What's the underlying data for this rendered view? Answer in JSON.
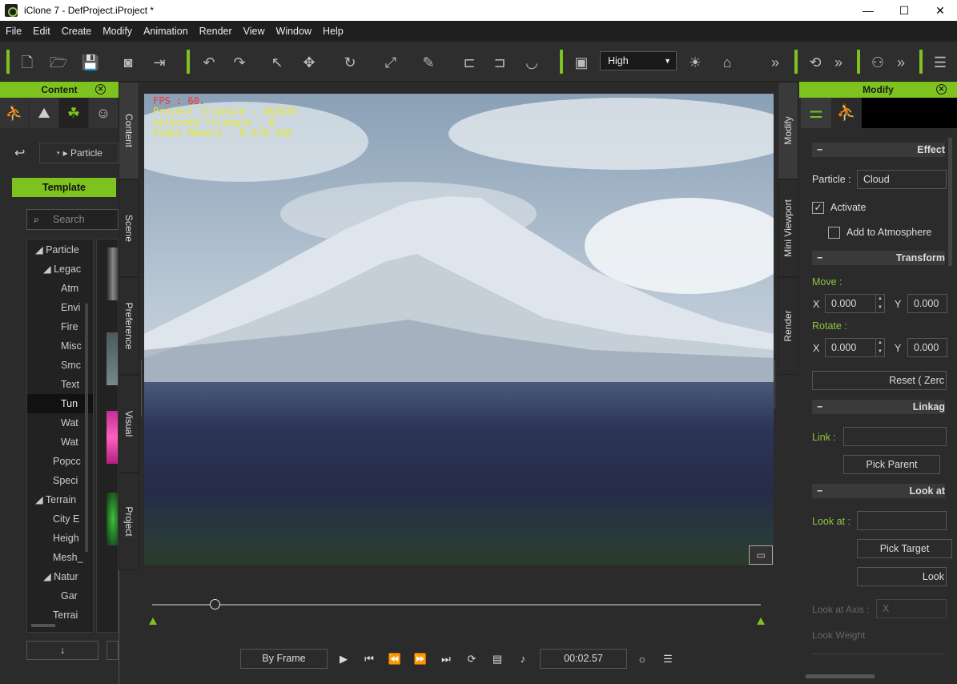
{
  "window": {
    "title": "iClone 7 - DefProject.iProject *",
    "minimize": "—",
    "maximize": "☐",
    "close": "✕"
  },
  "menu": [
    "File",
    "Edit",
    "Create",
    "Modify",
    "Animation",
    "Render",
    "View",
    "Window",
    "Help"
  ],
  "toolbar": {
    "quality": "High",
    "more1": "»",
    "more2": "»",
    "more3": "»"
  },
  "left": {
    "header": "Content",
    "breadcrumb": "Particle",
    "template_tab": "Template",
    "search_placeholder": "Search",
    "tree": [
      "Particle",
      "Legac",
      "Atm",
      "Envi",
      "Fire",
      "Misc",
      "Smc",
      "Text",
      "Tun",
      "Wat",
      "Wat",
      "Popcc",
      "Speci",
      "Terrain",
      "City E",
      "Heigh",
      "Mesh_",
      "Natur",
      "Gar",
      "Terrai"
    ],
    "down_arrow": "↓"
  },
  "sidetabs_left": [
    "Content",
    "Scene",
    "Preference",
    "Visual",
    "Project"
  ],
  "sidetabs_right": [
    "Modify",
    "Mini Viewport",
    "Render"
  ],
  "viewport": {
    "fps": "FPS : 60.",
    "triangles": "Project Triangle : 462635",
    "selected": "Selected Triangle : 0",
    "memory": "Video Memory : 0.5/8.1GB"
  },
  "playback": {
    "mode": "By Frame",
    "time": "00:02.57"
  },
  "right": {
    "header": "Modify",
    "effect_section": "Effect",
    "particle_label": "Particle :",
    "particle_value": "Cloud",
    "activate": "Activate",
    "add_atmosphere": "Add to Atmosphere",
    "transform_section": "Transform",
    "move_label": "Move :",
    "rotate_label": "Rotate :",
    "x_label": "X",
    "y_label": "Y",
    "move_x": "0.000",
    "move_y": "0.000",
    "rotate_x": "0.000",
    "rotate_y": "0.000",
    "reset": "Reset ( Zerc",
    "linkage_section": "Linkag",
    "link_label": "Link :",
    "pick_parent": "Pick Parent",
    "lookat_section": "Look at",
    "lookat_label": "Look at :",
    "pick_target": "Pick Target",
    "look_btn": "Look",
    "lookat_axis_label": "Look at Axis :",
    "lookat_axis_value": "X",
    "look_weight": "Look Weight"
  },
  "colors": {
    "accent": "#7dc21e",
    "hud_fps": "#ff3030",
    "hud_info": "#e8e820"
  }
}
